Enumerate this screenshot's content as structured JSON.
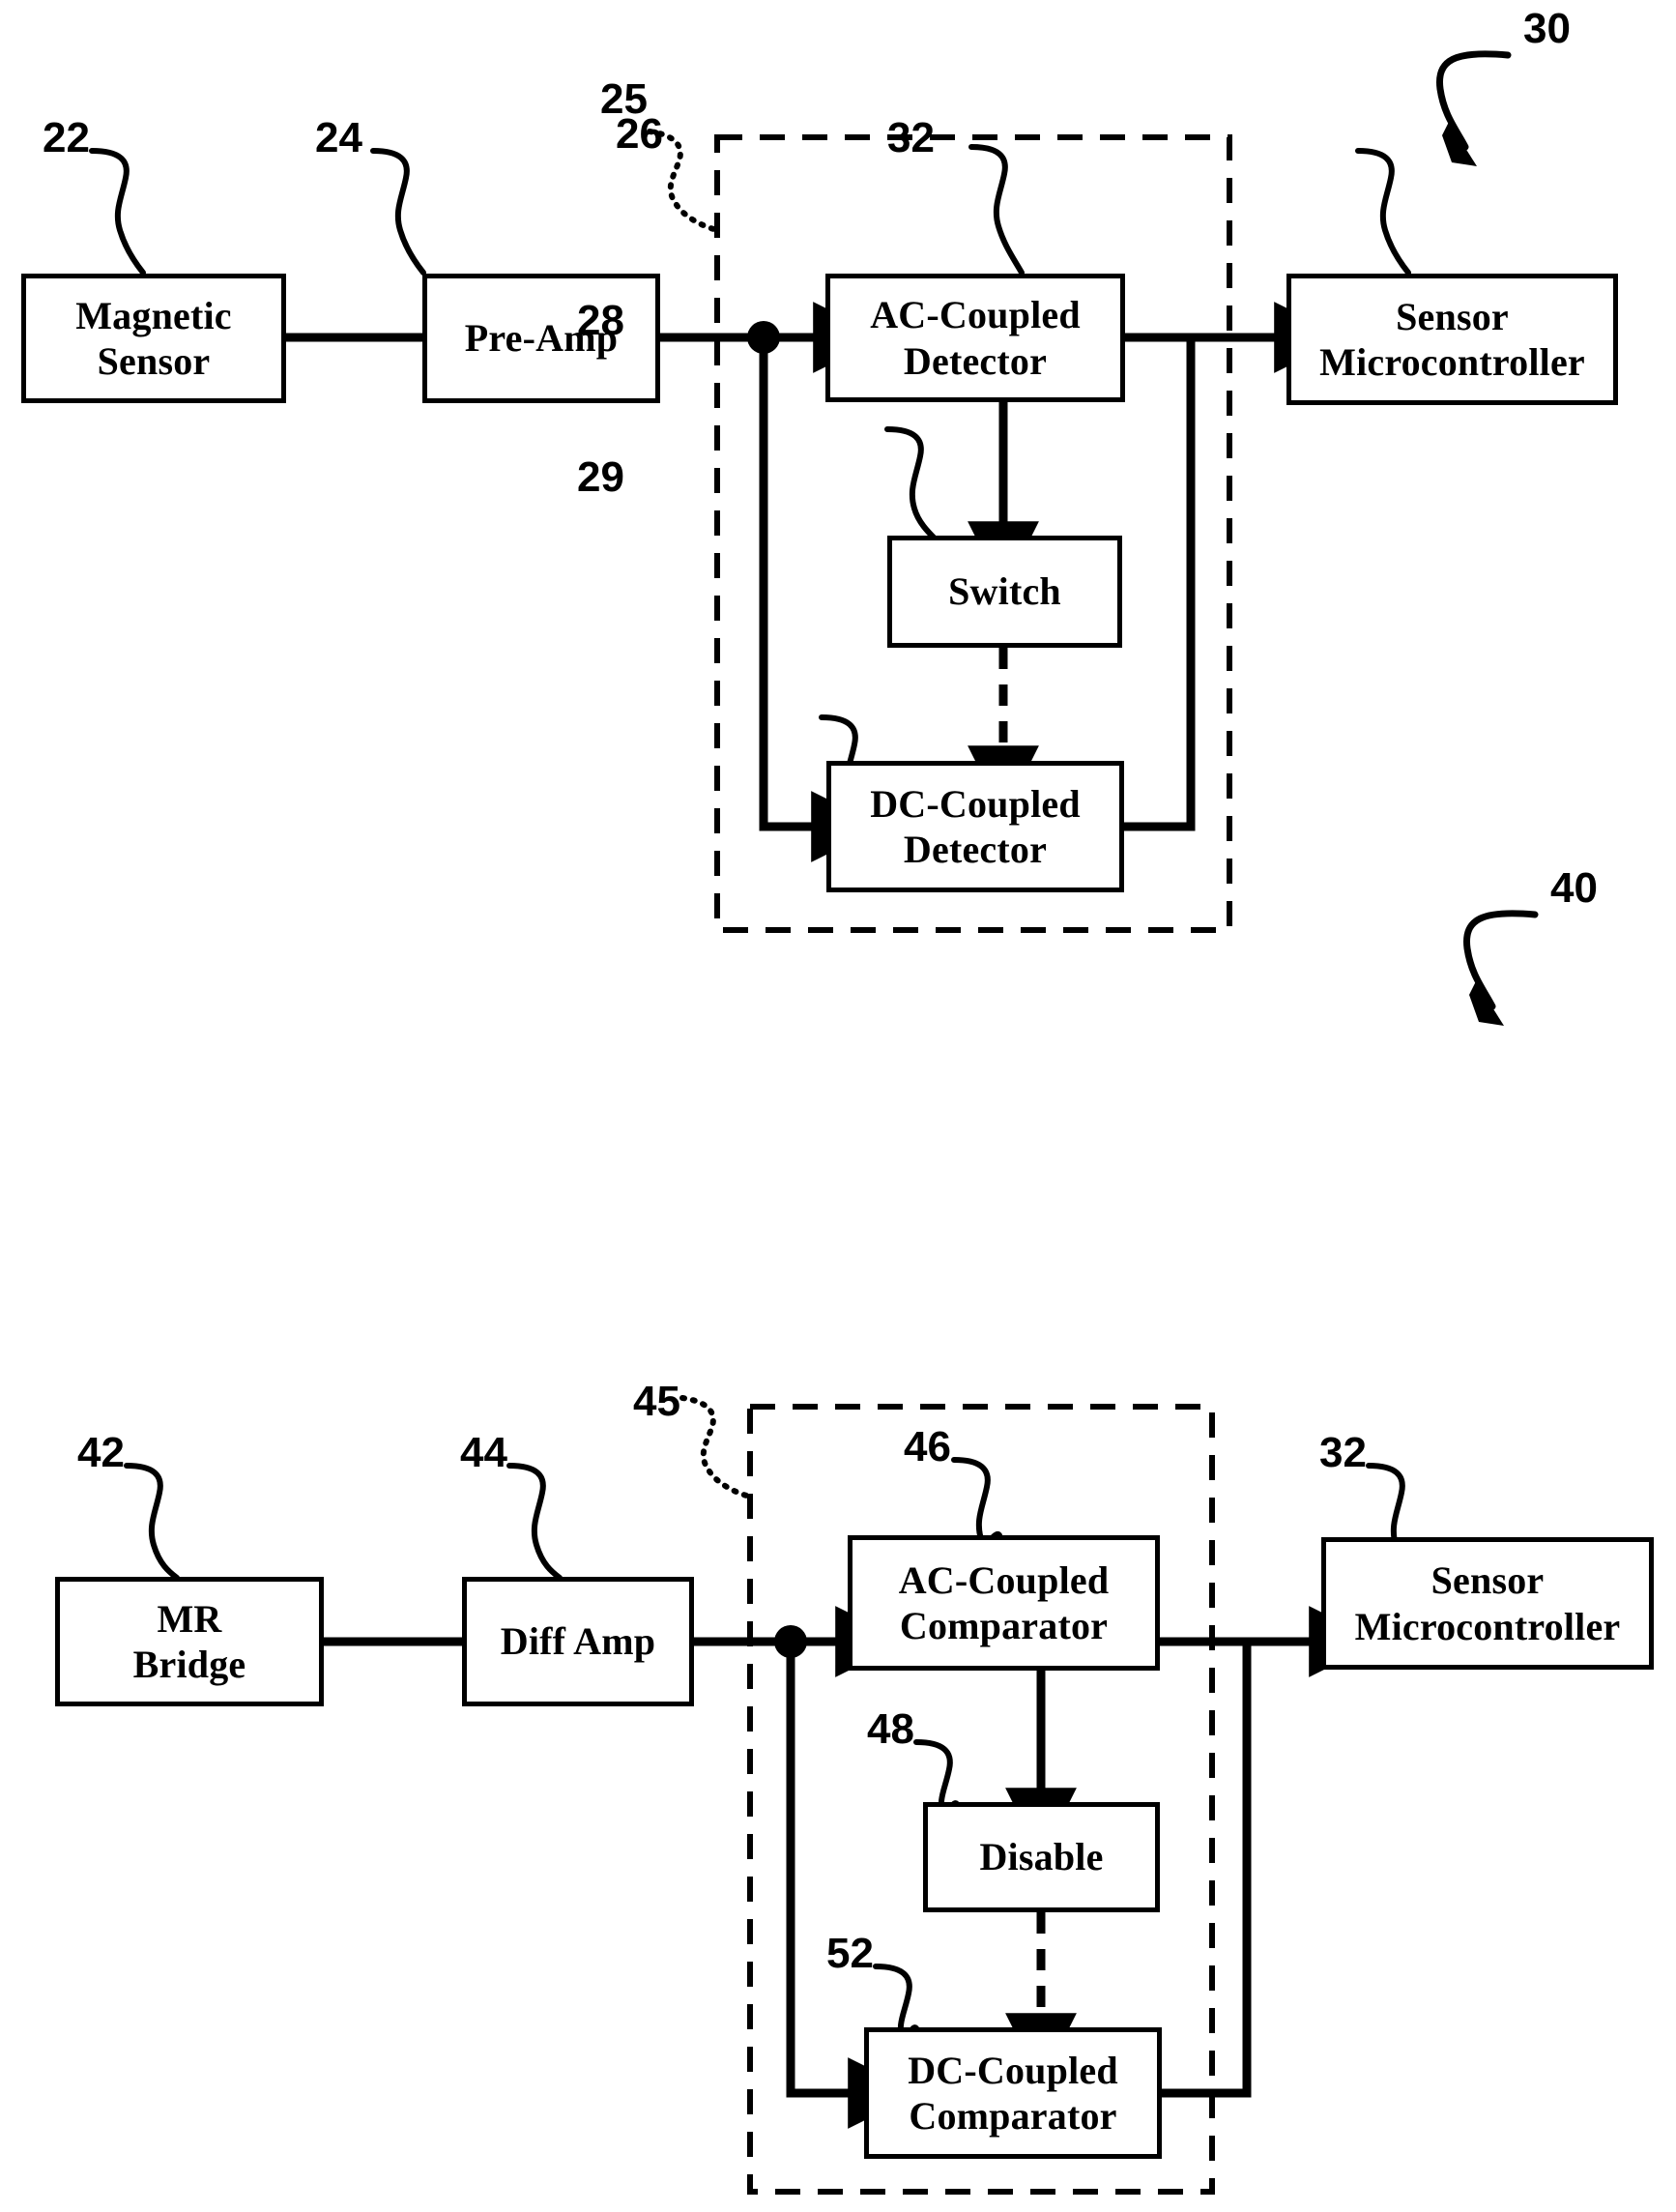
{
  "figure": {
    "background": "#ffffff",
    "ink": "#000000",
    "figure_numbers": [
      "30",
      "40"
    ]
  },
  "diagram_top": {
    "assembly_ref": "30",
    "dashed_group_ref": "25",
    "blocks": {
      "magnetic_sensor": {
        "ref": "22",
        "line1": "Magnetic",
        "line2": "Sensor"
      },
      "pre_amp": {
        "ref": "24",
        "line1": "Pre-Amp",
        "line2": ""
      },
      "ac_coupled_detector": {
        "ref": "26",
        "line1": "AC-Coupled",
        "line2": "Detector"
      },
      "switch": {
        "ref": "28",
        "line1": "Switch",
        "line2": ""
      },
      "dc_coupled_detector": {
        "ref": "29",
        "line1": "DC-Coupled",
        "line2": "Detector"
      },
      "sensor_microcontroller": {
        "ref": "32",
        "line1": "Sensor",
        "line2": "Microcontroller"
      }
    }
  },
  "diagram_bottom": {
    "assembly_ref": "40",
    "dashed_group_ref": "45",
    "blocks": {
      "mr_bridge": {
        "ref": "42",
        "line1": "MR",
        "line2": "Bridge"
      },
      "diff_amp": {
        "ref": "44",
        "line1": "Diff Amp",
        "line2": ""
      },
      "ac_coupled_comparator": {
        "ref": "46",
        "line1": "AC-Coupled",
        "line2": "Comparator"
      },
      "disable": {
        "ref": "48",
        "line1": "Disable",
        "line2": ""
      },
      "dc_coupled_comparator": {
        "ref": "52",
        "line1": "DC-Coupled",
        "line2": "Comparator"
      },
      "sensor_microcontroller": {
        "ref": "32",
        "line1": "Sensor",
        "line2": "Microcontroller"
      }
    }
  }
}
